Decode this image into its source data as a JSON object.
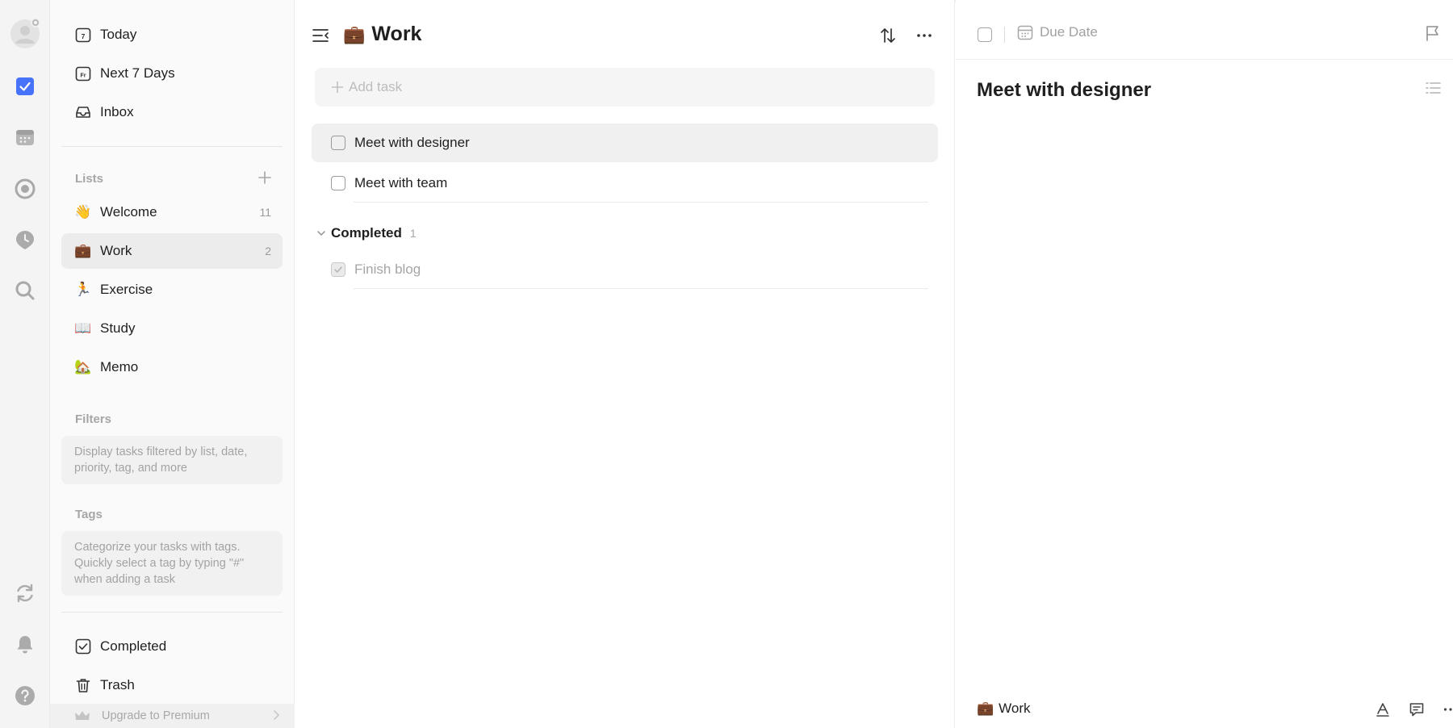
{
  "sidebar": {
    "smart_lists": [
      {
        "label": "Today",
        "icon": "calendar-today-icon"
      },
      {
        "label": "Next 7 Days",
        "icon": "calendar-week-icon"
      },
      {
        "label": "Inbox",
        "icon": "inbox-icon"
      }
    ],
    "lists_label": "Lists",
    "lists": [
      {
        "emoji": "👋",
        "label": "Welcome",
        "count": "11"
      },
      {
        "emoji": "💼",
        "label": "Work",
        "count": "2",
        "active": true
      },
      {
        "emoji": "🏃",
        "label": "Exercise",
        "count": ""
      },
      {
        "emoji": "📖",
        "label": "Study",
        "count": ""
      },
      {
        "emoji": "🏡",
        "label": "Memo",
        "count": ""
      }
    ],
    "filters_label": "Filters",
    "filters_hint": "Display tasks filtered by list, date, priority, tag, and more",
    "tags_label": "Tags",
    "tags_hint": "Categorize your tasks with tags. Quickly select a tag by typing \"#\" when adding a task",
    "bottom": [
      {
        "label": "Completed",
        "icon": "completed-icon"
      },
      {
        "label": "Trash",
        "icon": "trash-icon"
      }
    ],
    "upgrade_label": "Upgrade to Premium"
  },
  "main": {
    "title_emoji": "💼",
    "title": "Work",
    "add_task_placeholder": "Add task",
    "tasks": [
      {
        "title": "Meet with designer",
        "selected": true
      },
      {
        "title": "Meet with team",
        "selected": false
      }
    ],
    "completed_label": "Completed",
    "completed_count": "1",
    "completed_tasks": [
      {
        "title": "Finish blog"
      }
    ]
  },
  "detail": {
    "due_label": "Due Date",
    "title": "Meet with designer",
    "list_emoji": "💼",
    "list_name": "Work"
  },
  "colors": {
    "accent": "#4772fa",
    "rail_bg": "#f4f4f4",
    "sidebar_bg": "#fafafa",
    "selected_bg": "#ececec"
  }
}
